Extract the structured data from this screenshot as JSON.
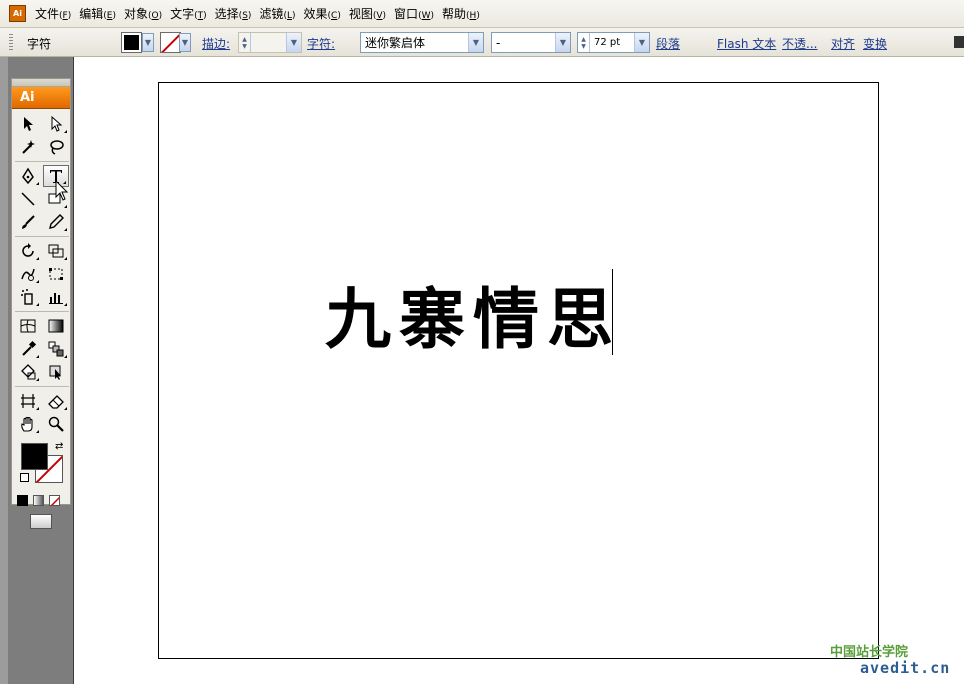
{
  "menubar": {
    "app_icon": "Ai",
    "items": [
      {
        "label": "文件",
        "key": "F"
      },
      {
        "label": "编辑",
        "key": "E"
      },
      {
        "label": "对象",
        "key": "O"
      },
      {
        "label": "文字",
        "key": "T"
      },
      {
        "label": "选择",
        "key": "S"
      },
      {
        "label": "滤镜",
        "key": "L"
      },
      {
        "label": "效果",
        "key": "C"
      },
      {
        "label": "视图",
        "key": "V"
      },
      {
        "label": "窗口",
        "key": "W"
      },
      {
        "label": "帮助",
        "key": "H"
      }
    ]
  },
  "controlbar": {
    "mode_label": "字符",
    "stroke_label": "描边:",
    "char_label": "字符:",
    "font_family": "迷你繁启体",
    "font_style": "-",
    "font_size": "72 pt",
    "paragraph_link": "段落",
    "flash_text_link": "Flash 文本",
    "opacity_link": "不透...",
    "align_link": "对齐",
    "transform_link": "变换",
    "fill_color": "#000000",
    "stroke_color": "none"
  },
  "tools": {
    "logo": "Ai",
    "selected_tool": "type-tool",
    "fill_color": "#000000",
    "stroke_color": "none"
  },
  "canvas": {
    "text": "九寨情思"
  },
  "watermark": {
    "line1": "中国站长学院",
    "line2": "avedit.cn"
  },
  "colors": {
    "accent_orange": "#e06800",
    "link_blue": "#1d3b8f",
    "stroke_none_red": "#c80000"
  }
}
